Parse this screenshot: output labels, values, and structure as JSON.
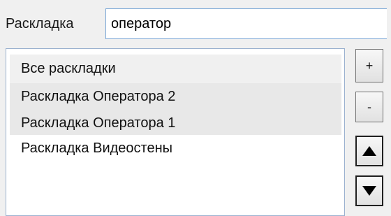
{
  "search": {
    "label": "Раскладка",
    "value": "оператор"
  },
  "list": {
    "header": "Все раскладки",
    "items": [
      {
        "label": "Раскладка Оператора 2",
        "selected": true
      },
      {
        "label": "Раскладка Оператора 1",
        "selected": true
      },
      {
        "label": "Раскладка Видеостены",
        "selected": false
      }
    ]
  },
  "buttons": {
    "add_label": "+",
    "remove_label": "-",
    "up_icon": "arrow-up-icon",
    "down_icon": "arrow-down-icon"
  },
  "colors": {
    "input_border": "#7aa7d6",
    "list_border": "#9ab1cf",
    "selected_row": "#e8e8e8",
    "window_bg": "#f0f0f0"
  }
}
